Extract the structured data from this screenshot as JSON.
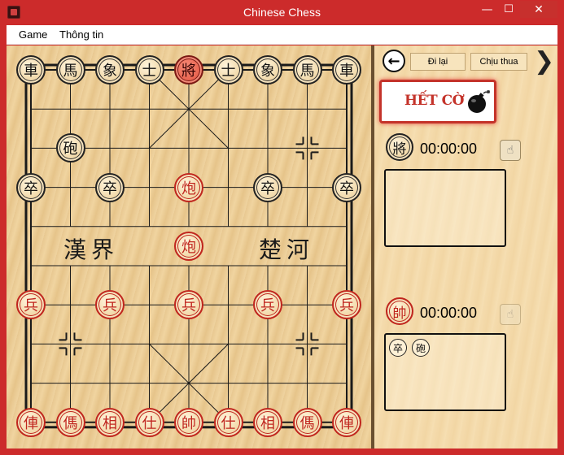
{
  "window": {
    "title": "Chinese Chess",
    "minimize": "—",
    "maximize": "☐",
    "close": "✕"
  },
  "menu": {
    "game": "Game",
    "info": "Thông tin"
  },
  "board": {
    "river_left": "漢界",
    "river_right": "楚河",
    "pieces": [
      {
        "id": "b-chariot-1",
        "char": "車",
        "color": "black",
        "file": 0,
        "rank": 0
      },
      {
        "id": "b-horse-1",
        "char": "馬",
        "color": "black",
        "file": 1,
        "rank": 0
      },
      {
        "id": "b-elephant-1",
        "char": "象",
        "color": "black",
        "file": 2,
        "rank": 0
      },
      {
        "id": "b-advisor-1",
        "char": "士",
        "color": "black",
        "file": 3,
        "rank": 0
      },
      {
        "id": "b-general",
        "char": "將",
        "color": "black",
        "file": 4,
        "rank": 0,
        "selected": true
      },
      {
        "id": "b-advisor-2",
        "char": "士",
        "color": "black",
        "file": 5,
        "rank": 0
      },
      {
        "id": "b-elephant-2",
        "char": "象",
        "color": "black",
        "file": 6,
        "rank": 0
      },
      {
        "id": "b-horse-2",
        "char": "馬",
        "color": "black",
        "file": 7,
        "rank": 0
      },
      {
        "id": "b-chariot-2",
        "char": "車",
        "color": "black",
        "file": 8,
        "rank": 0
      },
      {
        "id": "b-cannon",
        "char": "砲",
        "color": "black",
        "file": 1,
        "rank": 2
      },
      {
        "id": "b-soldier-1",
        "char": "卒",
        "color": "black",
        "file": 0,
        "rank": 3
      },
      {
        "id": "b-soldier-2",
        "char": "卒",
        "color": "black",
        "file": 2,
        "rank": 3
      },
      {
        "id": "r-cannon-1",
        "char": "炮",
        "color": "red",
        "file": 4,
        "rank": 3
      },
      {
        "id": "b-soldier-3",
        "char": "卒",
        "color": "black",
        "file": 6,
        "rank": 3
      },
      {
        "id": "b-soldier-4",
        "char": "卒",
        "color": "black",
        "file": 8,
        "rank": 3
      },
      {
        "id": "r-cannon-2",
        "char": "炮",
        "color": "red",
        "file": 4,
        "rank": 4.5
      },
      {
        "id": "r-soldier-1",
        "char": "兵",
        "color": "red",
        "file": 0,
        "rank": 6
      },
      {
        "id": "r-soldier-2",
        "char": "兵",
        "color": "red",
        "file": 2,
        "rank": 6
      },
      {
        "id": "r-soldier-3",
        "char": "兵",
        "color": "red",
        "file": 4,
        "rank": 6
      },
      {
        "id": "r-soldier-4",
        "char": "兵",
        "color": "red",
        "file": 6,
        "rank": 6
      },
      {
        "id": "r-soldier-5",
        "char": "兵",
        "color": "red",
        "file": 8,
        "rank": 6
      },
      {
        "id": "r-chariot-1",
        "char": "俥",
        "color": "red",
        "file": 0,
        "rank": 9
      },
      {
        "id": "r-horse-1",
        "char": "傌",
        "color": "red",
        "file": 1,
        "rank": 9
      },
      {
        "id": "r-elephant-1",
        "char": "相",
        "color": "red",
        "file": 2,
        "rank": 9
      },
      {
        "id": "r-advisor-1",
        "char": "仕",
        "color": "red",
        "file": 3,
        "rank": 9
      },
      {
        "id": "r-general",
        "char": "帥",
        "color": "red",
        "file": 4,
        "rank": 9
      },
      {
        "id": "r-advisor-2",
        "char": "仕",
        "color": "red",
        "file": 5,
        "rank": 9
      },
      {
        "id": "r-elephant-2",
        "char": "相",
        "color": "red",
        "file": 6,
        "rank": 9
      },
      {
        "id": "r-horse-2",
        "char": "傌",
        "color": "red",
        "file": 7,
        "rank": 9
      },
      {
        "id": "r-chariot-2",
        "char": "俥",
        "color": "red",
        "file": 8,
        "rank": 9
      }
    ]
  },
  "panel": {
    "back_icon": "arrow-left-circle-icon",
    "undo_label": "Đi lại",
    "resign_label": "Chịu thua",
    "next_symbol": "❯",
    "timeout_text": "HẾT CỜ",
    "top_player": {
      "piece": "將",
      "timer": "00:00:00"
    },
    "bottom_player": {
      "piece": "帥",
      "timer": "00:00:00",
      "captured": [
        "卒",
        "砲"
      ]
    }
  },
  "colors": {
    "titlebar": "#cc2b2b",
    "red_piece": "#c0261e",
    "selected_piece": "#e65c48",
    "board_wood": "#ecce98"
  }
}
